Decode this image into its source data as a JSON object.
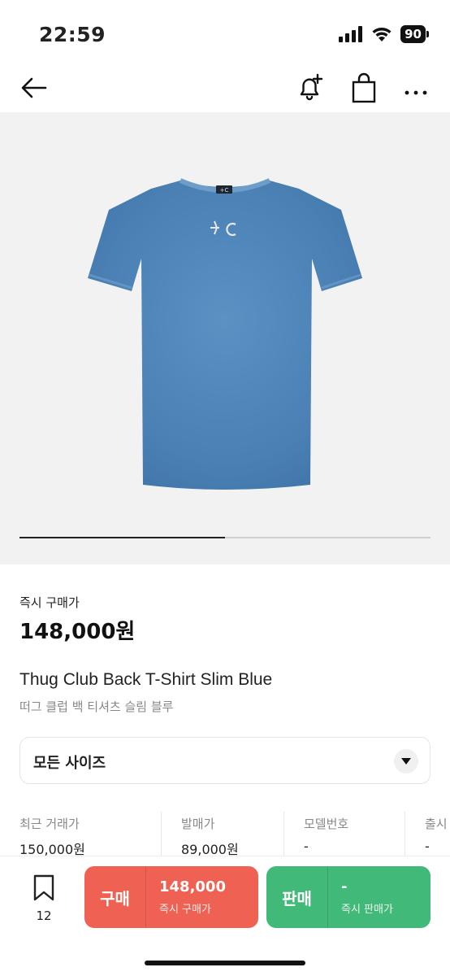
{
  "status_bar": {
    "time": "22:59",
    "battery": "90",
    "icons": [
      "signal-icon",
      "wifi-icon",
      "battery-icon"
    ]
  },
  "nav": {
    "icons": [
      "back-arrow-icon",
      "bell-add-icon",
      "shopping-bag-icon",
      "more-icon"
    ]
  },
  "gallery": {
    "progress": 0.5
  },
  "price": {
    "label": "즉시 구매가",
    "value": "148,000원"
  },
  "product": {
    "name_en": "Thug Club Back T-Shirt Slim Blue",
    "name_ko": "떠그 클럽 백 티셔츠 슬림 블루",
    "shirt_color": "#4f86b8"
  },
  "size_select": {
    "selected": "모든 사이즈",
    "icon": "chevron-down-icon"
  },
  "info": [
    {
      "label": "최근 거래가",
      "value": "150,000원"
    },
    {
      "label": "발매가",
      "value": "89,000원"
    },
    {
      "label": "모델번호",
      "value": "-"
    },
    {
      "label": "출시",
      "value": "-"
    }
  ],
  "bottom": {
    "wish_count": "12",
    "buy": {
      "label": "구매",
      "price": "148,000",
      "sub": "즉시 구매가"
    },
    "sell": {
      "label": "판매",
      "price": "-",
      "sub": "즉시 판매가"
    }
  },
  "colors": {
    "buy": "#ef6253",
    "sell": "#41b979",
    "image_bg": "#f2f2f2"
  }
}
